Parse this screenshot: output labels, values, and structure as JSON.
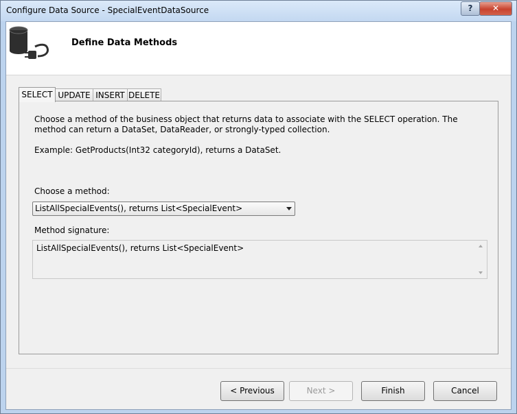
{
  "window": {
    "title": "Configure Data Source - SpecialEventDataSource",
    "help_label": "?",
    "close_label": "✕"
  },
  "header": {
    "title": "Define Data Methods",
    "icon": "database-plug-icon"
  },
  "tabs": [
    {
      "label": "SELECT",
      "active": true
    },
    {
      "label": "UPDATE",
      "active": false
    },
    {
      "label": "INSERT",
      "active": false
    },
    {
      "label": "DELETE",
      "active": false
    }
  ],
  "select_tab": {
    "description": "Choose a method of the business object that returns data to associate with the SELECT operation. The method can return a DataSet, DataReader, or strongly-typed collection.",
    "example": "Example: GetProducts(Int32 categoryId), returns a DataSet.",
    "choose_label": "Choose a method:",
    "method_value": "ListAllSpecialEvents(), returns List<SpecialEvent>",
    "signature_label": "Method signature:",
    "signature_value": "ListAllSpecialEvents(), returns List<SpecialEvent>"
  },
  "buttons": {
    "previous": "< Previous",
    "next": "Next >",
    "finish": "Finish",
    "cancel": "Cancel"
  }
}
